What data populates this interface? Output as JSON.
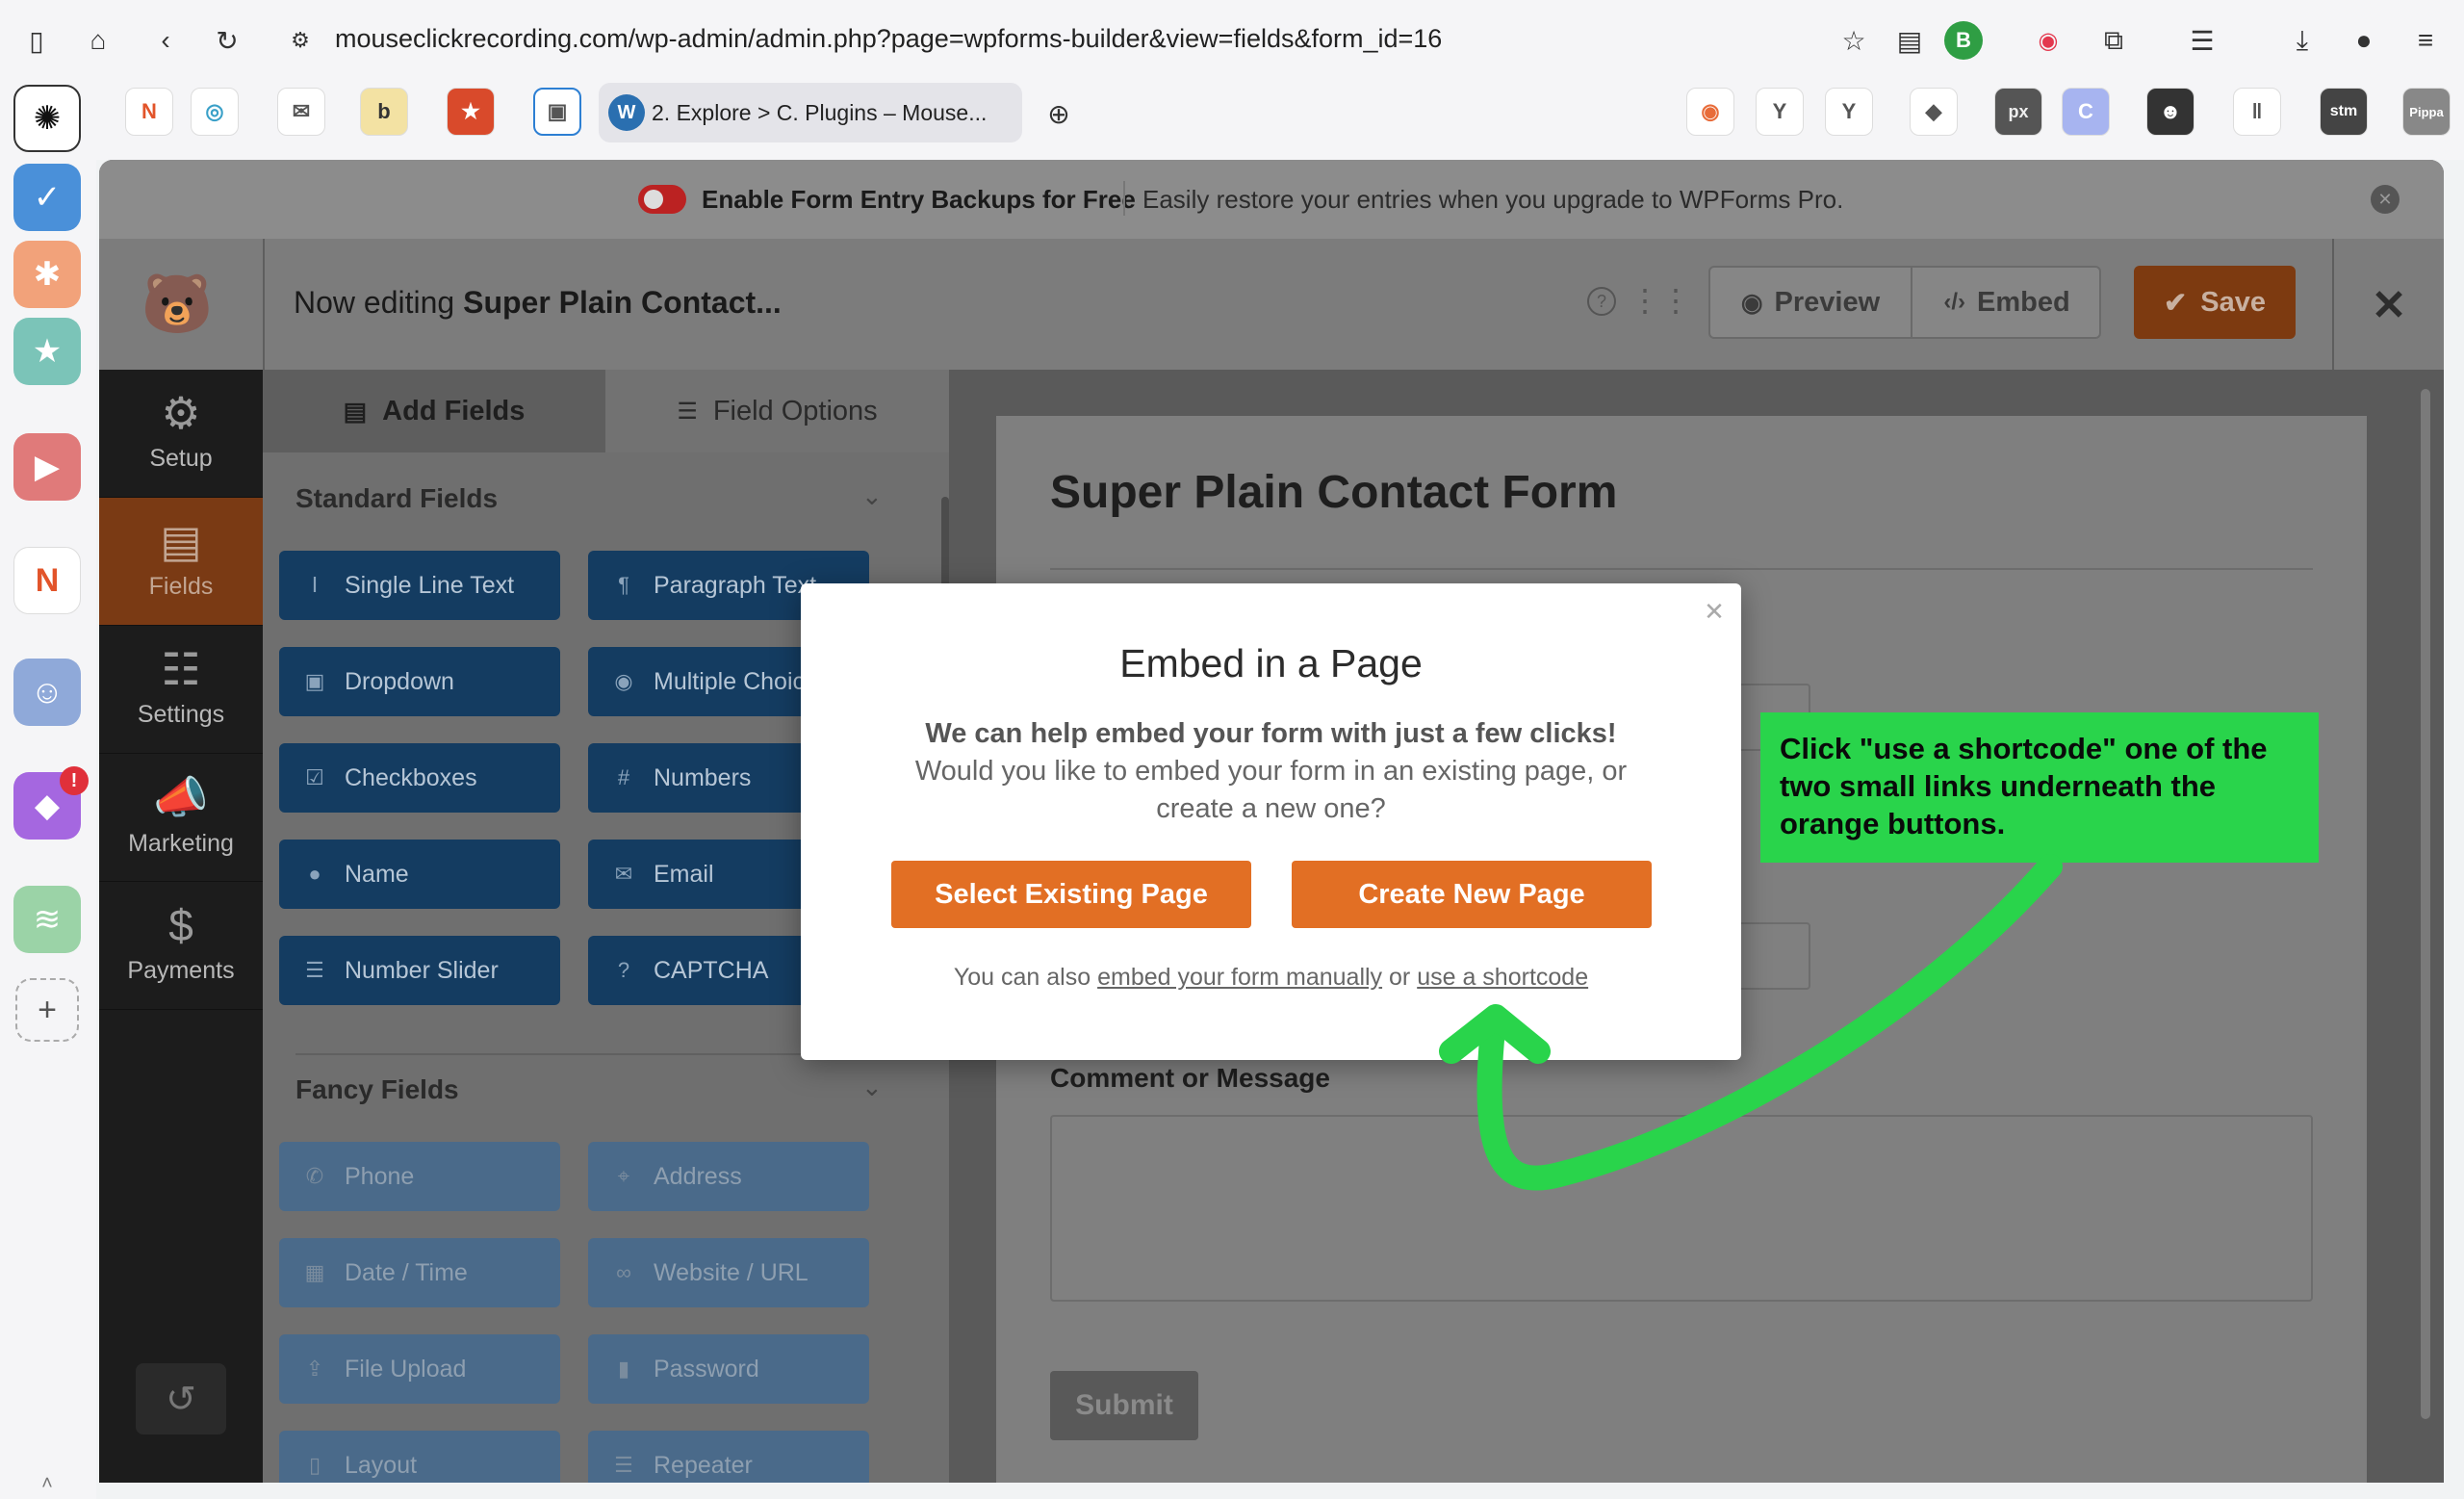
{
  "browser": {
    "url": "mouseclickrecording.com/wp-admin/admin.php?page=wpforms-builder&view=fields&form_id=16",
    "active_tab_title": "2. Explore > C. Plugins – Mouse...",
    "profile_initial": "B",
    "pinned_tabs": [
      "b",
      "px",
      "stm",
      "Pippa"
    ]
  },
  "banner": {
    "title": "Enable Form Entry Backups for Free",
    "text": "Easily restore your entries when you upgrade to WPForms Pro."
  },
  "header": {
    "editing_prefix": "Now editing",
    "form_name": "Super Plain Contact...",
    "preview_label": "Preview",
    "embed_label": "Embed",
    "save_label": "Save"
  },
  "nav": [
    {
      "label": "Setup",
      "icon": "gear-icon"
    },
    {
      "label": "Fields",
      "icon": "fields-icon"
    },
    {
      "label": "Settings",
      "icon": "sliders-icon"
    },
    {
      "label": "Marketing",
      "icon": "megaphone-icon"
    },
    {
      "label": "Payments",
      "icon": "dollar-icon"
    }
  ],
  "panel": {
    "tab_add": "Add Fields",
    "tab_options": "Field Options",
    "standard_title": "Standard Fields",
    "standard_fields": [
      "Single Line Text",
      "Paragraph Text",
      "Dropdown",
      "Multiple Choice",
      "Checkboxes",
      "Numbers",
      "Name",
      "Email",
      "Number Slider",
      "CAPTCHA"
    ],
    "fancy_title": "Fancy Fields",
    "fancy_fields": [
      "Phone",
      "Address",
      "Date / Time",
      "Website / URL",
      "File Upload",
      "Password",
      "Layout",
      "Repeater"
    ]
  },
  "form": {
    "title": "Super Plain Contact Form",
    "comment_label": "Comment or Message",
    "submit_label": "Submit"
  },
  "modal": {
    "title": "Embed in a Page",
    "line1": "We can help embed your form with just a few clicks!",
    "line2": "Would you like to embed your form in an existing page, or",
    "line3": "create a new one?",
    "btn_existing": "Select Existing Page",
    "btn_new": "Create New Page",
    "footer_prefix": "You can also",
    "link_manual": "embed your form manually",
    "footer_or": "or",
    "link_shortcode": "use a shortcode"
  },
  "callout": {
    "text": "Click \"use a shortcode\" one of the two small links underneath the orange buttons.",
    "color": "#29d44b"
  },
  "colors": {
    "accent": "#e26f24",
    "field_button": "#143c61",
    "annotation": "#29d44b"
  }
}
